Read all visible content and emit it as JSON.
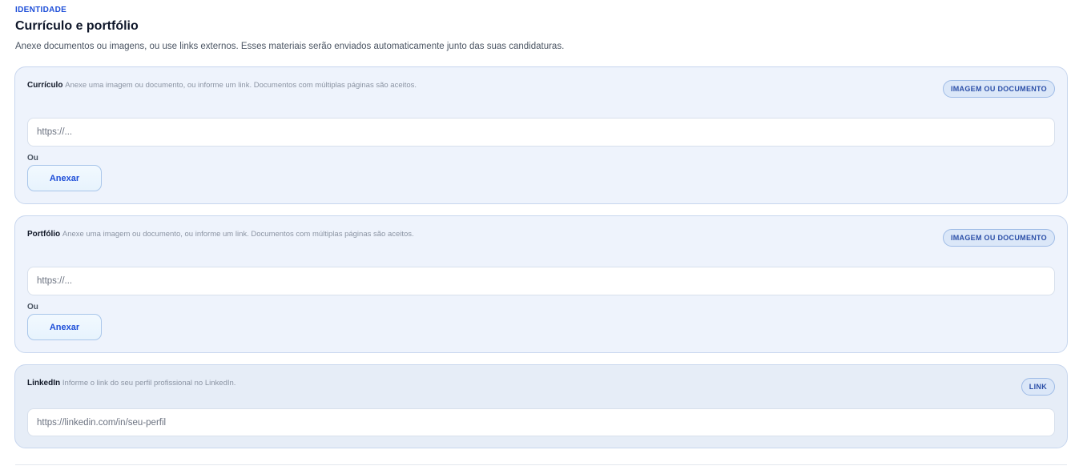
{
  "section": {
    "eyebrow": "IDENTIDADE",
    "title": "Currículo e portfólio",
    "description": "Anexe documentos ou imagens, ou use links externos. Esses materiais serão enviados automaticamente junto das suas candidaturas."
  },
  "cards": {
    "curriculo": {
      "label": "Currículo",
      "hint": "Anexe uma imagem ou documento, ou informe um link. Documentos com múltiplas páginas são aceitos.",
      "badge": "IMAGEM OU DOCUMENTO",
      "placeholder": "https://...",
      "or_label": "Ou",
      "attach_label": "Anexar"
    },
    "portfolio": {
      "label": "Portfólio",
      "hint": "Anexe uma imagem ou documento, ou informe um link. Documentos com múltiplas páginas são aceitos.",
      "badge": "IMAGEM OU DOCUMENTO",
      "placeholder": "https://...",
      "or_label": "Ou",
      "attach_label": "Anexar"
    },
    "linkedin": {
      "label": "LinkedIn",
      "hint": "Informe o link do seu perfil profissional no LinkedIn.",
      "badge": "LINK",
      "placeholder": "https://linkedin.com/in/seu-perfil"
    }
  },
  "colors": {
    "accent": "#1d4ed8",
    "card_bg": "#eef3fc",
    "card_border": "#c7d6ee"
  }
}
